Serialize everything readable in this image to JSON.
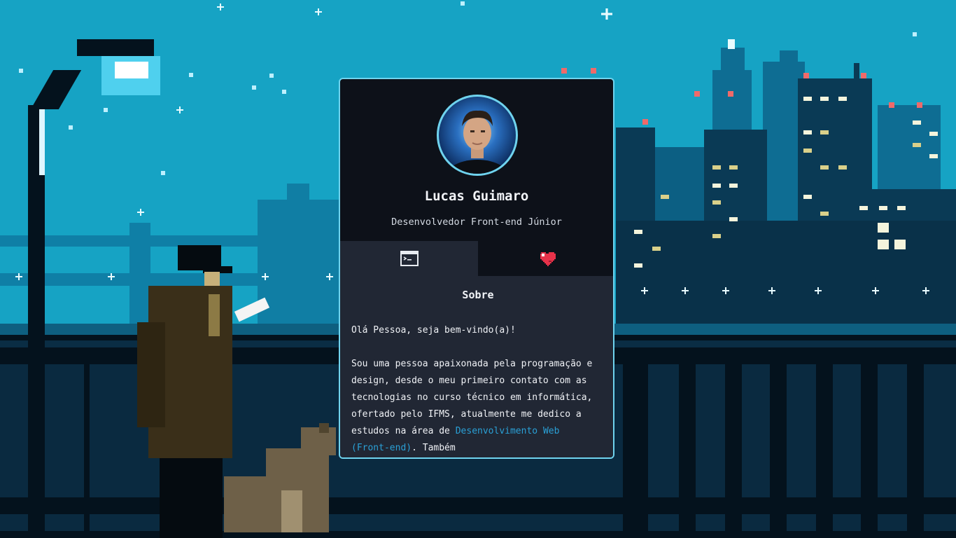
{
  "profile": {
    "name": "Lucas Guimaro",
    "role": "Desenvolvedor Front-end Júnior"
  },
  "tabs": [
    {
      "id": "about",
      "icon": "terminal-icon",
      "active": true
    },
    {
      "id": "likes",
      "icon": "heart-icon",
      "active": false
    }
  ],
  "about": {
    "title": "Sobre",
    "greeting": "Olá Pessoa, seja bem-vindo(a)!",
    "paragraph_start": "Sou uma pessoa apaixonada pela programação e design, desde o meu primeiro contato com as tecnologias no curso técnico em informática, ofertado pelo IFMS, atualmente me dedico a estudos na área de",
    "link_text": "Desenvolvimento Web (Front-end)",
    "paragraph_end": ". Também"
  },
  "colors": {
    "sky": "#16a3c4",
    "card_bg": "#0d1119",
    "panel_bg": "#212734",
    "accent": "#6fd3ee",
    "link": "#2aa0d6",
    "heart": "#e8324a"
  }
}
